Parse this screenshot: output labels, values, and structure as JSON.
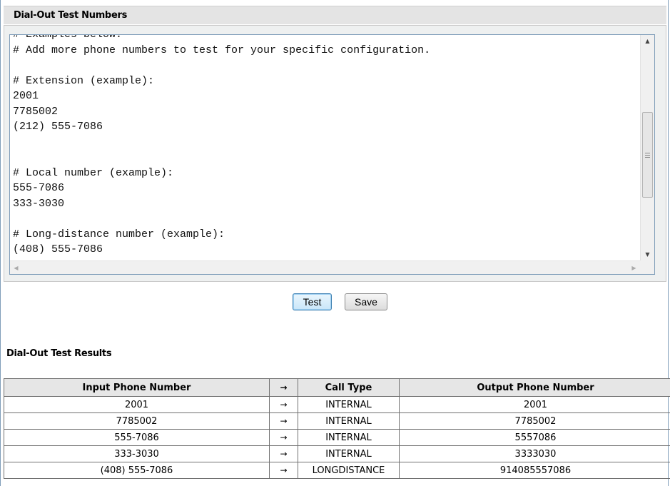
{
  "config_section": {
    "title": "Dial-Out Test Numbers",
    "editor_lines": [
      "# Examples below:",
      "# Add more phone numbers to test for your specific configuration.",
      "",
      "# Extension (example):",
      "2001",
      "7785002",
      "(212) 555-7086",
      "",
      "",
      "# Local number (example):",
      "555-7086",
      "333-3030",
      "",
      "# Long-distance number (example):",
      "(408) 555-7086"
    ]
  },
  "buttons": {
    "test_label": "Test",
    "save_label": "Save"
  },
  "results_section": {
    "title": "Dial-Out Test Results",
    "columns": {
      "input": "Input Phone Number",
      "arrow": "→",
      "call_type": "Call Type",
      "output": "Output Phone Number"
    },
    "rows": [
      {
        "input": "2001",
        "arrow": "→",
        "call_type": "INTERNAL",
        "output": "2001"
      },
      {
        "input": "7785002",
        "arrow": "→",
        "call_type": "INTERNAL",
        "output": "7785002"
      },
      {
        "input": "555-7086",
        "arrow": "→",
        "call_type": "INTERNAL",
        "output": "5557086"
      },
      {
        "input": "333-3030",
        "arrow": "→",
        "call_type": "INTERNAL",
        "output": "3333030"
      },
      {
        "input": "(408) 555-7086",
        "arrow": "→",
        "call_type": "LONGDISTANCE",
        "output": "914085557086"
      }
    ]
  }
}
